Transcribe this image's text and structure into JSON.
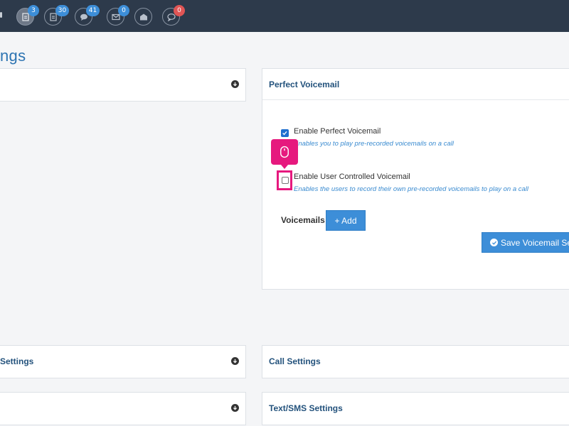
{
  "topbar": {
    "icons": [
      {
        "name": "fax-icon",
        "badge": "3",
        "active": true
      },
      {
        "name": "document-icon",
        "badge": "30"
      },
      {
        "name": "chat-icon",
        "badge": "41"
      },
      {
        "name": "mail-icon",
        "badge": "0"
      },
      {
        "name": "open-mail-icon",
        "badge": ""
      },
      {
        "name": "comment-icon",
        "badge": "0"
      }
    ]
  },
  "page_title": "ngs",
  "panels": {
    "voicemail": {
      "title": "Perfect Voicemail",
      "option1": {
        "label": "Enable Perfect Voicemail",
        "help": "Enables you to play pre-recorded voicemails on a call",
        "checked": true
      },
      "option2": {
        "label": "Enable User Controlled Voicemail",
        "help": "Enables the users to record their own pre-recorded voicemails to play on a call",
        "checked": false
      },
      "voicemails_label": "Voicemails",
      "add_button": "+ Add",
      "save_button": "Save Voicemail Settings"
    },
    "left_bottom_1": {
      "title": "Settings"
    },
    "call_settings": {
      "title": "Call Settings"
    },
    "text_sms": {
      "title": "Text/SMS Settings"
    }
  },
  "colors": {
    "accent": "#3d8ed8",
    "highlight": "#e6197e",
    "topbar": "#2d3a4b"
  }
}
